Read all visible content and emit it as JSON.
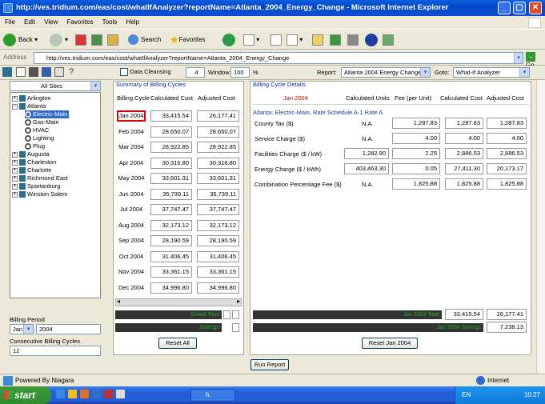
{
  "window": {
    "title": "http://ves.tridium.com/eas/cost/whatIfAnalyzer?reportName=Atlanta_2004_Energy_Change - Microsoft Internet Explorer"
  },
  "menu": [
    "File",
    "Edit",
    "View",
    "Favorites",
    "Tools",
    "Help"
  ],
  "toolbar": {
    "back": "Back",
    "search": "Search",
    "favorites": "Favorites"
  },
  "address": {
    "label": "Address",
    "url": "http://ves.tridium.com/eas/cost/whatIfAnalyzer?reportName=Atlanta_2004_Energy_Change",
    "go": "Go"
  },
  "appbar": {
    "data_cleansing": "Data Cleansing",
    "window_value": "4",
    "window_label": "Window",
    "percent_value": "100",
    "percent_label": "%",
    "report_label": "Report:",
    "report_value": "Atlanta 2004 Energy Change",
    "goto_label": "Goto:",
    "goto_value": "What-If Analyzer"
  },
  "sites": {
    "selected": "All Sites",
    "tree": [
      "Arlington",
      "Atlanta",
      "Electric-Main",
      "Gas-Main",
      "HVAC",
      "Lighting",
      "Plug",
      "Augusta",
      "Charleston",
      "Charlotte",
      "Richmond East",
      "Spartanburg",
      "Winston Salem"
    ]
  },
  "billing": {
    "period_label": "Billing Period",
    "month": "Jan",
    "year": "2004",
    "consecutive_label": "Consecutive Billing Cycles",
    "consecutive_value": "12"
  },
  "summary": {
    "title": "Summary of Billing Cycles",
    "headers": [
      "Billing Cycle",
      "Calculated Cost",
      "Adjusted Cost"
    ],
    "rows": [
      [
        "Jan 2004",
        "33,415.54",
        "26,177.41"
      ],
      [
        "Feb 2004",
        "28,650.07",
        "28,650.07"
      ],
      [
        "Mar 2004",
        "28,922.85",
        "28,922.85"
      ],
      [
        "Apr 2004",
        "30,316.80",
        "30,316.80"
      ],
      [
        "May 2004",
        "33,601.31",
        "33,601.31"
      ],
      [
        "Jun 2004",
        "35,739.11",
        "35,739.11"
      ],
      [
        "Jul 2004",
        "37,747.47",
        "37,747.47"
      ],
      [
        "Aug 2004",
        "32,173.12",
        "32,173.12"
      ],
      [
        "Sep 2004",
        "28,190.59",
        "28,190.59"
      ],
      [
        "Oct 2004",
        "31,406.45",
        "31,406.45"
      ],
      [
        "Nov 2004",
        "33,361.15",
        "33,361.15"
      ],
      [
        "Dec 2004",
        "34,996.80",
        "34,996.80"
      ]
    ],
    "grand_total": "Grand Total",
    "savings": "Savings",
    "reset_all": "Reset All"
  },
  "details": {
    "title": "Billing Cycle Details",
    "headers": [
      "Jan 2004",
      "Calculated Units",
      "Fee (per Unit)",
      "Calculated Cost",
      "Adjusted Cost"
    ],
    "schedule": "Atlanta: Electric-Main, Rate Schedule A-1 Rate A",
    "rows": [
      [
        "County Tax ($)",
        "N.A.",
        "1,287.83",
        "1,287.83",
        "1,287.83"
      ],
      [
        "Service Charge ($)",
        "N.A.",
        "4.00",
        "4.00",
        "4.00"
      ],
      [
        "Facilities Charge ($ / kW)",
        "1,282.90",
        "2.25",
        "2,886.53",
        "2,886.53"
      ],
      [
        "Energy Charge ($ / kWh)",
        "403,463.30",
        "0.05",
        "27,411.30",
        "20,173.17"
      ],
      [
        "Combination Percentage Fee ($)",
        "N.A.",
        "1,825.88",
        "1,825.88",
        "1,825.88"
      ]
    ],
    "total_label": "Jan 2004 Total",
    "total_calc": "33,415.54",
    "total_adj": "26,177.41",
    "savings_label": "Jan 2004 Savings",
    "savings_value": "7,238.13",
    "reset": "Reset Jan 2004"
  },
  "run_report": "Run Report",
  "status": {
    "left": "Powered By Niagara",
    "zone": "Internet"
  },
  "taskbar": {
    "start": "start",
    "lang": "EN",
    "clock": "10:27",
    "task": "h."
  }
}
